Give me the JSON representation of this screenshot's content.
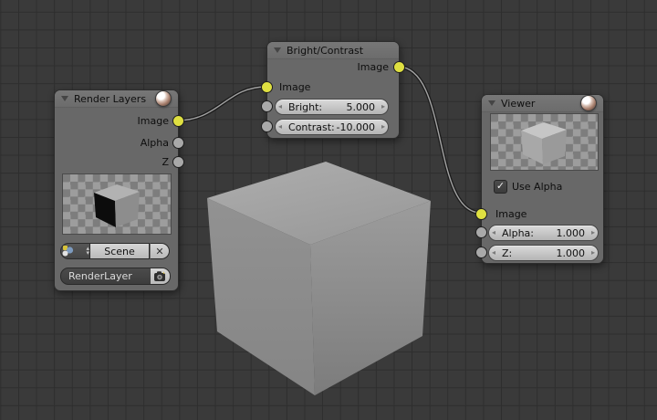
{
  "editor": {
    "background": "#3a3a3a",
    "grid_line": "#2e2e2e",
    "node_body": "#686868",
    "socket_image_color": "#dfe041",
    "socket_value_color": "#a9a9a9"
  },
  "glyphs": {
    "close": "✕",
    "check": "✓",
    "arrow_up": "▴",
    "arrow_down": "▾",
    "arrow_left": "◂",
    "arrow_right": "▸"
  },
  "nodes": {
    "render_layers": {
      "title": "Render Layers",
      "outputs": [
        {
          "label": "Image",
          "type": "image"
        },
        {
          "label": "Alpha",
          "type": "value"
        },
        {
          "label": "Z",
          "type": "value"
        }
      ],
      "scene_value": "Scene",
      "layer_value": "RenderLayer"
    },
    "bright_contrast": {
      "title": "Bright/Contrast",
      "output_label": "Image",
      "input_label": "Image",
      "sliders": [
        {
          "label": "Bright:",
          "value": "5.000"
        },
        {
          "label": "Contrast:",
          "value": "-10.000"
        }
      ]
    },
    "viewer": {
      "title": "Viewer",
      "use_alpha_label": "Use Alpha",
      "use_alpha_checked": true,
      "input_label": "Image",
      "sliders": [
        {
          "label": "Alpha:",
          "value": "1.000"
        },
        {
          "label": "Z:",
          "value": "1.000"
        }
      ]
    }
  }
}
